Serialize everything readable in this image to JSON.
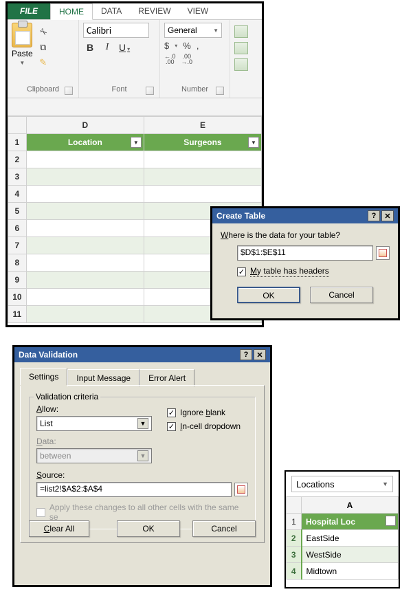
{
  "ribbon": {
    "tabs": {
      "file": "FILE",
      "home": "HOME",
      "data": "DATA",
      "review": "REVIEW",
      "view": "VIEW"
    },
    "clipboard": {
      "paste": "Paste",
      "group_label": "Clipboard"
    },
    "font": {
      "name": "Calibri",
      "bold": "B",
      "italic": "I",
      "underline": "U",
      "group_label": "Font"
    },
    "number": {
      "format": "General",
      "currency": "$",
      "percent": "%",
      "comma": ",",
      "dec_inc_top": "←.0",
      "dec_inc_bot": ".00",
      "dec_dec_top": ".00",
      "dec_dec_bot": "→.0",
      "group_label": "Number"
    }
  },
  "grid": {
    "columns": [
      "D",
      "E"
    ],
    "headers": [
      "Location",
      "Surgeons"
    ],
    "rows": [
      1,
      2,
      3,
      4,
      5,
      6,
      7,
      8,
      9,
      10,
      11
    ]
  },
  "create_table": {
    "title": "Create Table",
    "prompt_pre": "W",
    "prompt_post": "here is the data for your table?",
    "range": "$D$1:$E$11",
    "headers_pre": "M",
    "headers_post": "y table has headers",
    "headers_checked": true,
    "ok": "OK",
    "cancel": "Cancel"
  },
  "data_validation": {
    "title": "Data Validation",
    "tabs": {
      "settings": "Settings",
      "input_msg": "Input Message",
      "error_alert": "Error Alert"
    },
    "legend": "Validation criteria",
    "allow_label_pre": "A",
    "allow_label_post": "llow:",
    "allow_value": "List",
    "data_label_pre": "D",
    "data_label_post": "ata:",
    "data_value": "between",
    "ignore_blank_pre": "Ignore ",
    "ignore_blank_u": "b",
    "ignore_blank_post": "lank",
    "ignore_blank_checked": true,
    "incell_pre": "I",
    "incell_post": "n-cell dropdown",
    "incell_checked": true,
    "source_label_pre": "S",
    "source_label_post": "ource:",
    "source_value": "=list2!$A$2:$A$4",
    "apply_text": "Apply these changes to all other cells with the same se",
    "clear_pre": "C",
    "clear_post": "lear All",
    "ok": "OK",
    "cancel": "Cancel"
  },
  "list_panel": {
    "namebox": "Locations",
    "col": "A",
    "header": "Hospital Loc",
    "rows": [
      {
        "n": 1,
        "v": ""
      },
      {
        "n": 2,
        "v": "EastSide"
      },
      {
        "n": 3,
        "v": "WestSide"
      },
      {
        "n": 4,
        "v": "Midtown"
      }
    ]
  }
}
